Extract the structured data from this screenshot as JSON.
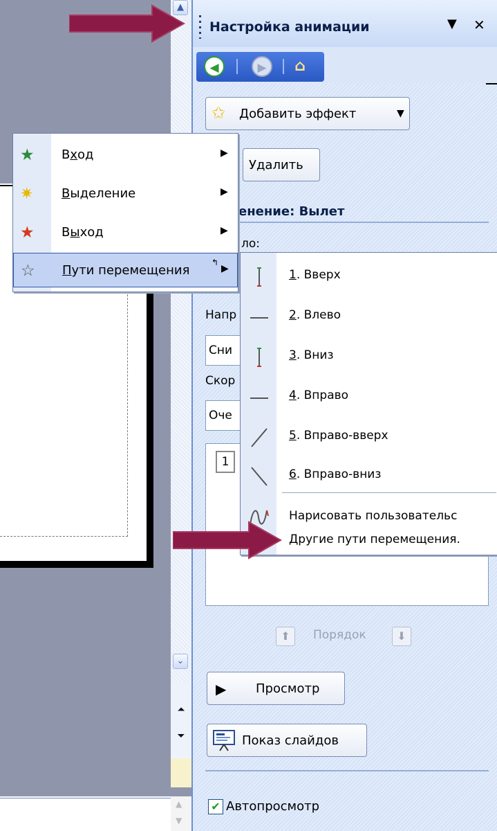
{
  "task_pane": {
    "title": "Настройка анимации",
    "add_effect_label": "Добавить эффект",
    "delete_label": "Удалить",
    "section_label": "енение: Вылет",
    "start_label": "ло:",
    "direction_label": "Напр",
    "direction_value": "Сни",
    "speed_label": "Скор",
    "speed_value": "Оче",
    "list_number": "1",
    "order_label": "Порядок",
    "preview_label": "Просмотр",
    "slideshow_label": "Показ слайдов",
    "autopreview_label": "Автопросмотр",
    "autopreview_checked": true
  },
  "effect_menu": {
    "items": [
      {
        "prefix": "В",
        "mnemonic": "х",
        "suffix": "од",
        "icon": "entrance-star-icon",
        "icon_color": "#2e8b3a"
      },
      {
        "prefix": "",
        "mnemonic": "В",
        "suffix": "ыделение",
        "icon": "emphasis-star-icon",
        "icon_color": "#e6b800"
      },
      {
        "prefix": "В",
        "mnemonic": "ы",
        "suffix": "ход",
        "icon": "exit-star-icon",
        "icon_color": "#d23a1e"
      },
      {
        "prefix": "",
        "mnemonic": "П",
        "suffix": "ути перемещения",
        "icon": "motion-path-star-icon",
        "icon_color": "#ffffff"
      }
    ]
  },
  "motion_paths_menu": {
    "items": [
      {
        "num": "1",
        "text": ". Вверх",
        "icon": "vertical-line-icon"
      },
      {
        "num": "2",
        "text": ". Влево",
        "icon": "horizontal-line-icon"
      },
      {
        "num": "3",
        "text": ". Вниз",
        "icon": "vertical-line-icon"
      },
      {
        "num": "4",
        "text": ". Вправо",
        "icon": "horizontal-line-icon"
      },
      {
        "num": "5",
        "text": ". Вправо-вверх",
        "icon": "diagonal-up-line-icon"
      },
      {
        "num": "6",
        "text": ". Вправо-вниз",
        "icon": "diagonal-down-line-icon"
      }
    ],
    "draw_custom": "Нарисовать пользовательс",
    "more_paths_prefix": "Д",
    "more_paths_suffix": "ругие пути перемещения."
  },
  "colors": {
    "annotation_arrow": "#8b1a46",
    "pane_background": "#dbe7f9",
    "nav_bar": "#3a69d6"
  }
}
